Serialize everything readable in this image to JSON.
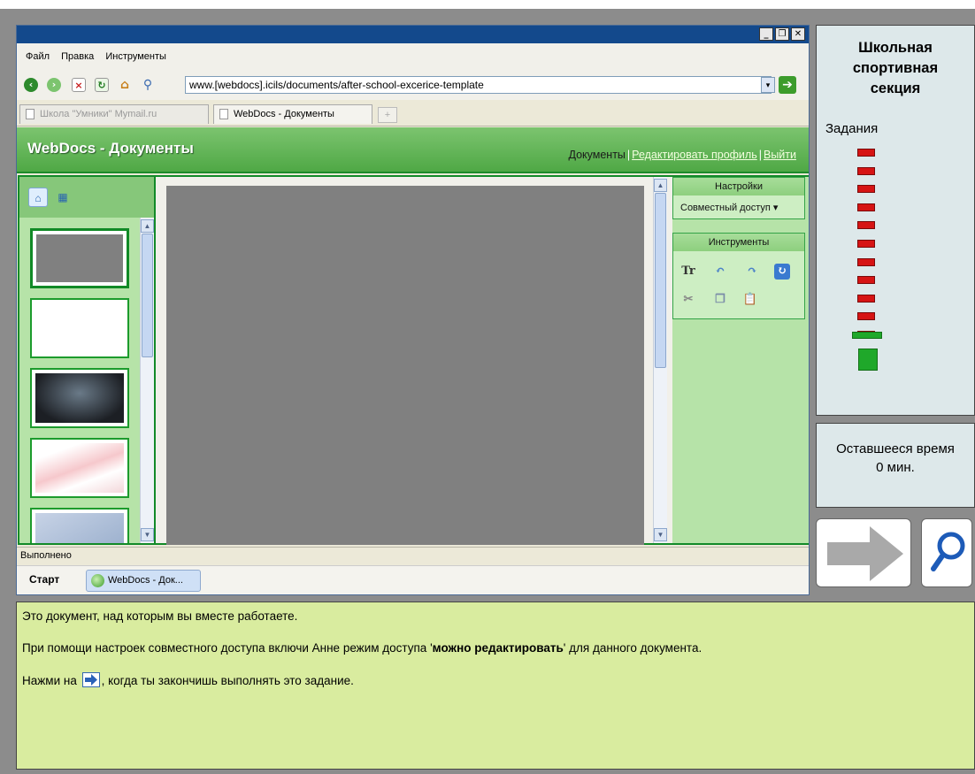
{
  "browser": {
    "menu": [
      "Файл",
      "Правка",
      "Инструменты"
    ],
    "window_buttons": [
      "minimize",
      "restore",
      "close"
    ],
    "url": "www.[webdocs].icils/documents/after-school-excerice-template",
    "tabs": [
      {
        "label": "Школа \"Умники\" Mymail.ru",
        "active": false
      },
      {
        "label": "WebDocs - Документы",
        "active": true
      }
    ],
    "new_tab_label": "+",
    "status": "Выполнено"
  },
  "app": {
    "title": "WebDocs - Документы",
    "links": {
      "documents": "Документы",
      "edit_profile": "Редактировать профиль",
      "logout": "Выйти"
    },
    "settings": {
      "header": "Настройки",
      "share_dropdown": "Совместный доступ ▾"
    },
    "tools": {
      "header": "Инструменты"
    }
  },
  "taskbar": {
    "start": "Старт",
    "window_item": "WebDocs - Док..."
  },
  "side_panel": {
    "title": "Школьная\nспортивная\nсекция",
    "tasks_label": "Задания",
    "tasks_done": 11,
    "time_label": "Оставшееся время",
    "time_value": "0 мин."
  },
  "instructions": {
    "line1": "Это документ, над которым вы вместе работаете.",
    "line2_prefix": "При помощи настроек совместного доступа включи Анне режим доступа '",
    "line2_bold": "можно редактировать",
    "line2_suffix": "' для данного документа.",
    "line3_prefix": "Нажми на ",
    "line3_suffix": ", когда ты закончишь выполнять это задание."
  },
  "colors": {
    "accent_green": "#4fa845",
    "task_done": "#d61414",
    "task_current": "#1fa82a",
    "instruction_bg": "#d9ec9f"
  }
}
